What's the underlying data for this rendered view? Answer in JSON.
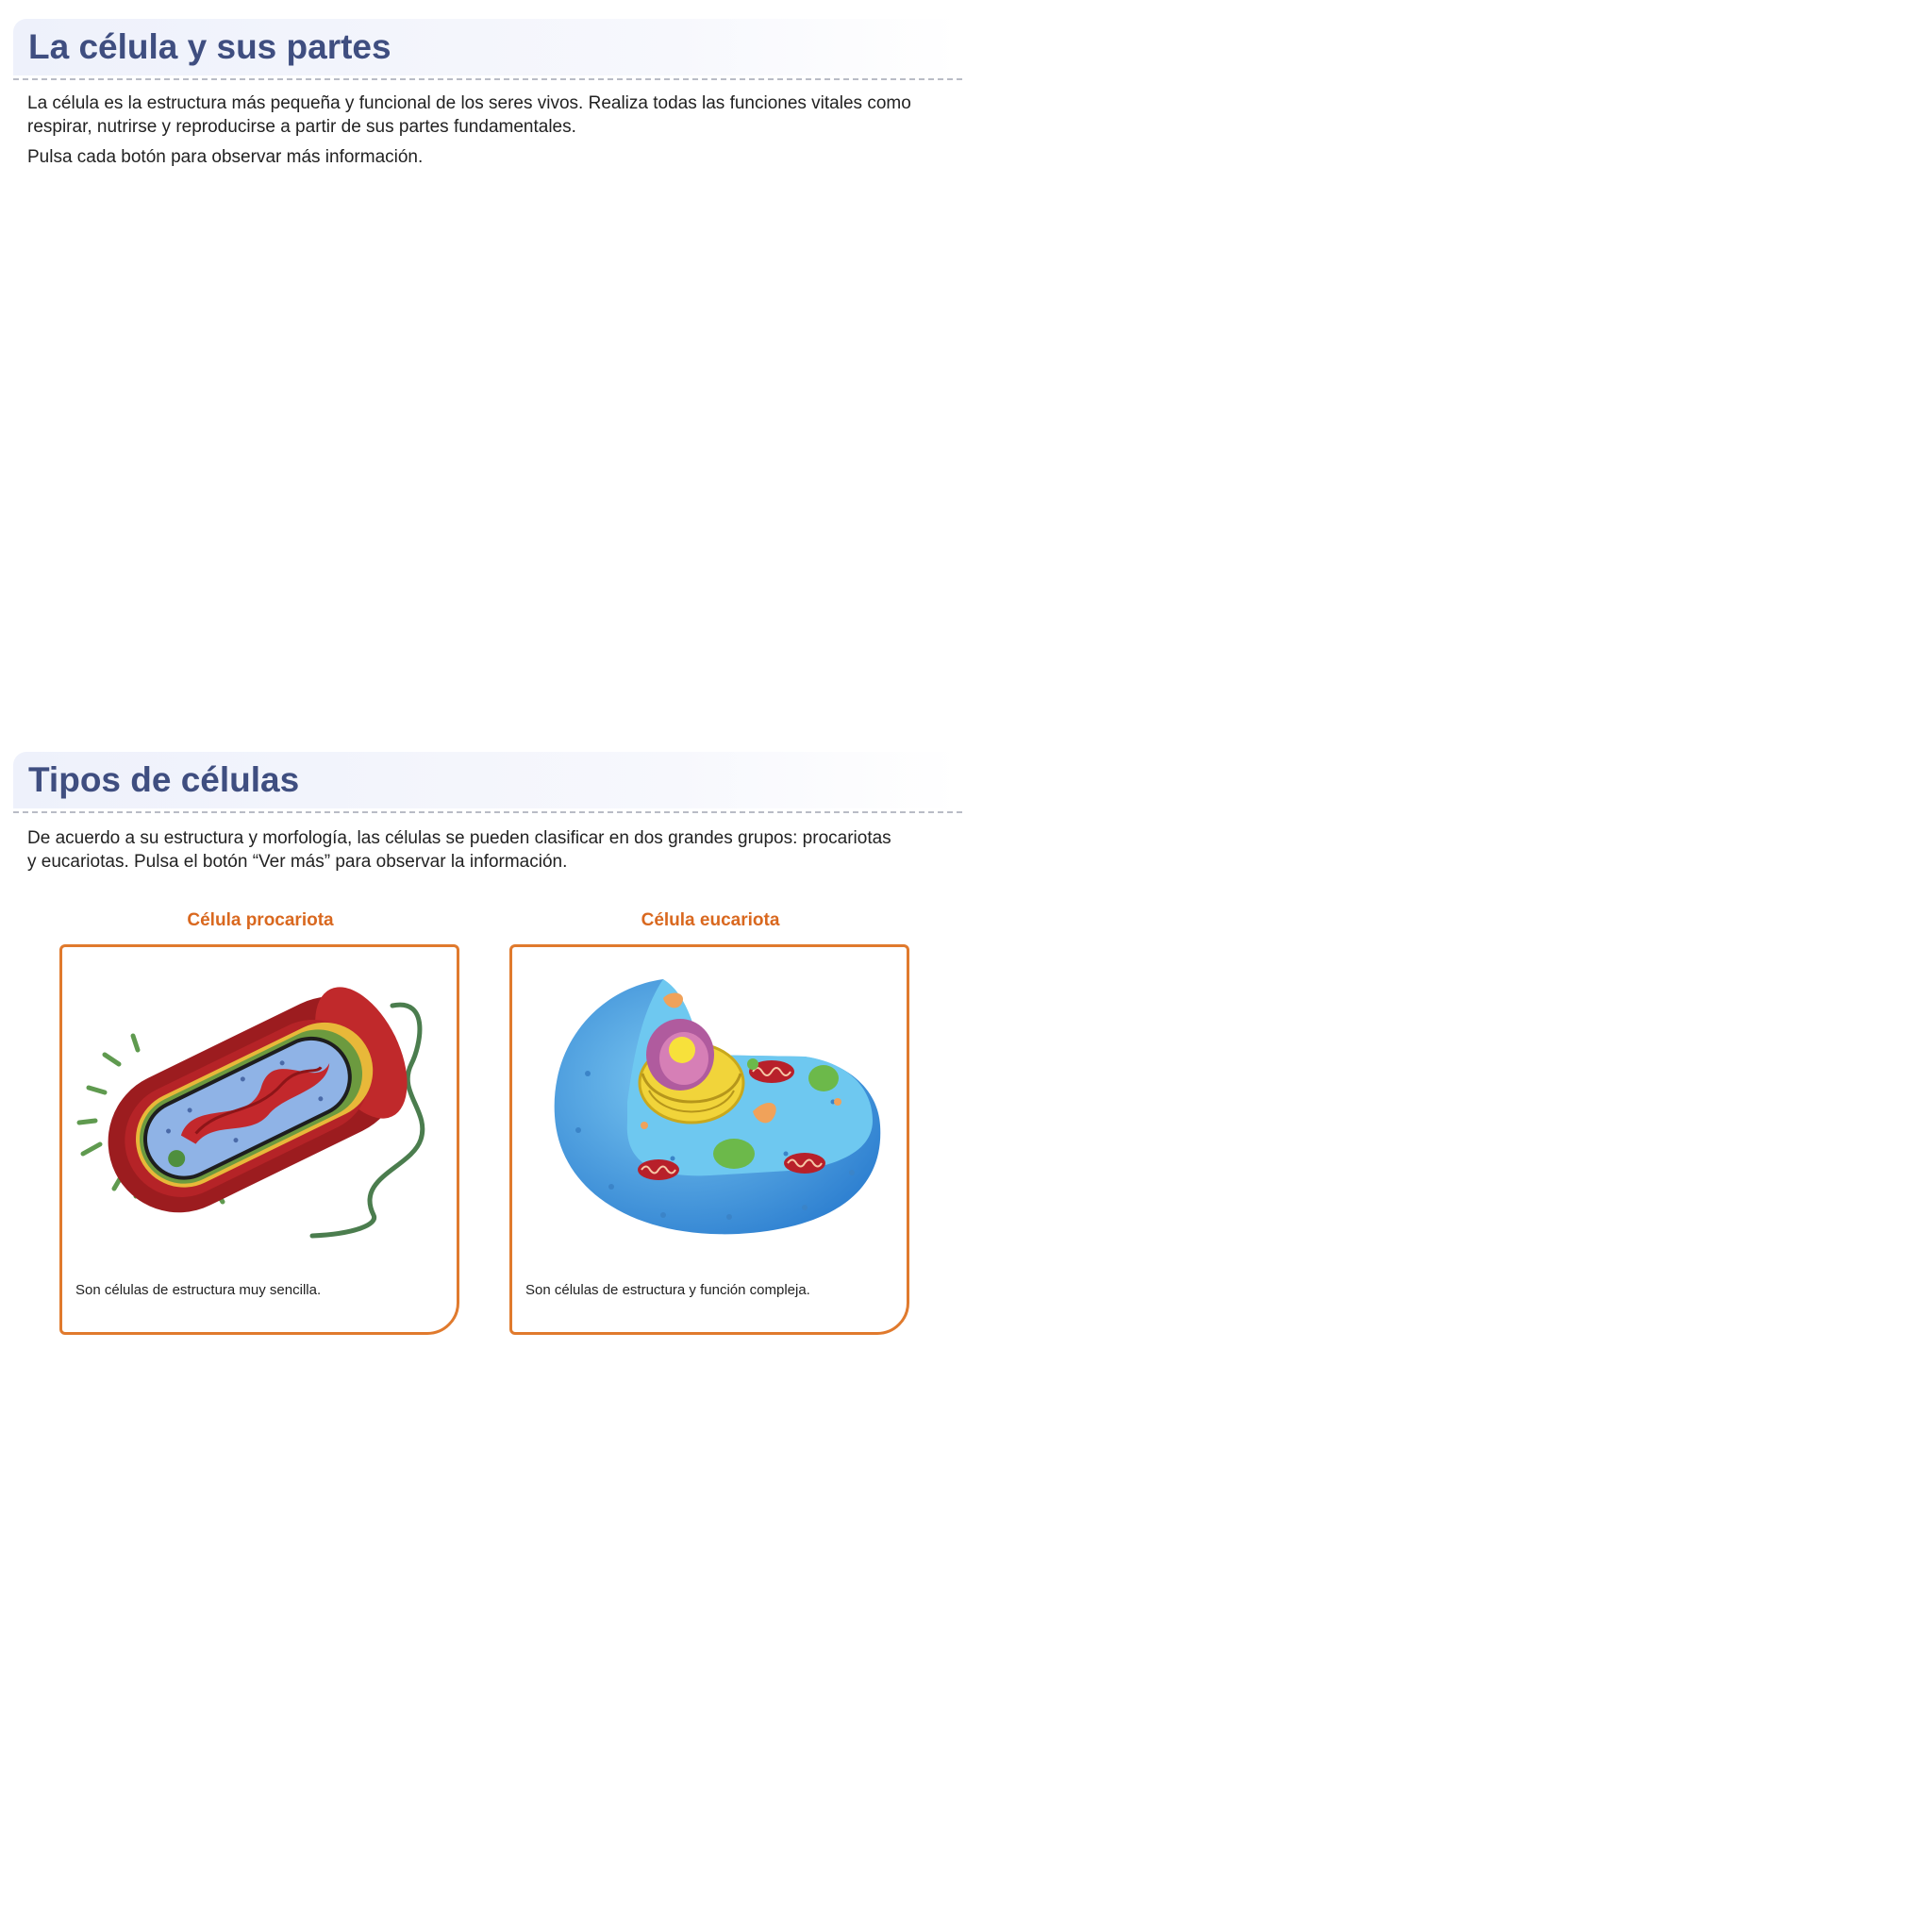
{
  "section1": {
    "title": "La célula y sus partes",
    "paragraph1_line1": "La célula es la estructura más pequeña y funcional de los seres vivos. Realiza todas las funciones vitales como",
    "paragraph1_line2": "respirar, nutrirse y reproducirse a partir de sus partes fundamentales.",
    "paragraph2": "Pulsa cada botón para observar más información."
  },
  "section2": {
    "title": "Tipos de células",
    "paragraph_line1": "De acuerdo a su estructura y morfología, las células se pueden clasificar en dos grandes grupos: procariotas",
    "paragraph_line2": "y eucariotas. Pulsa el botón “Ver más” para observar la información.",
    "cards": [
      {
        "title": "Célula procariota",
        "description": "Son células de estructura muy sencilla.",
        "image": "prokaryotic-cell-illustration"
      },
      {
        "title": "Célula eucariota",
        "description": "Son células de estructura y función compleja.",
        "image": "eukaryotic-cell-illustration"
      }
    ]
  },
  "colors": {
    "heading": "#3f4e80",
    "accent_orange": "#e07a2d",
    "card_title": "#d9681f"
  }
}
